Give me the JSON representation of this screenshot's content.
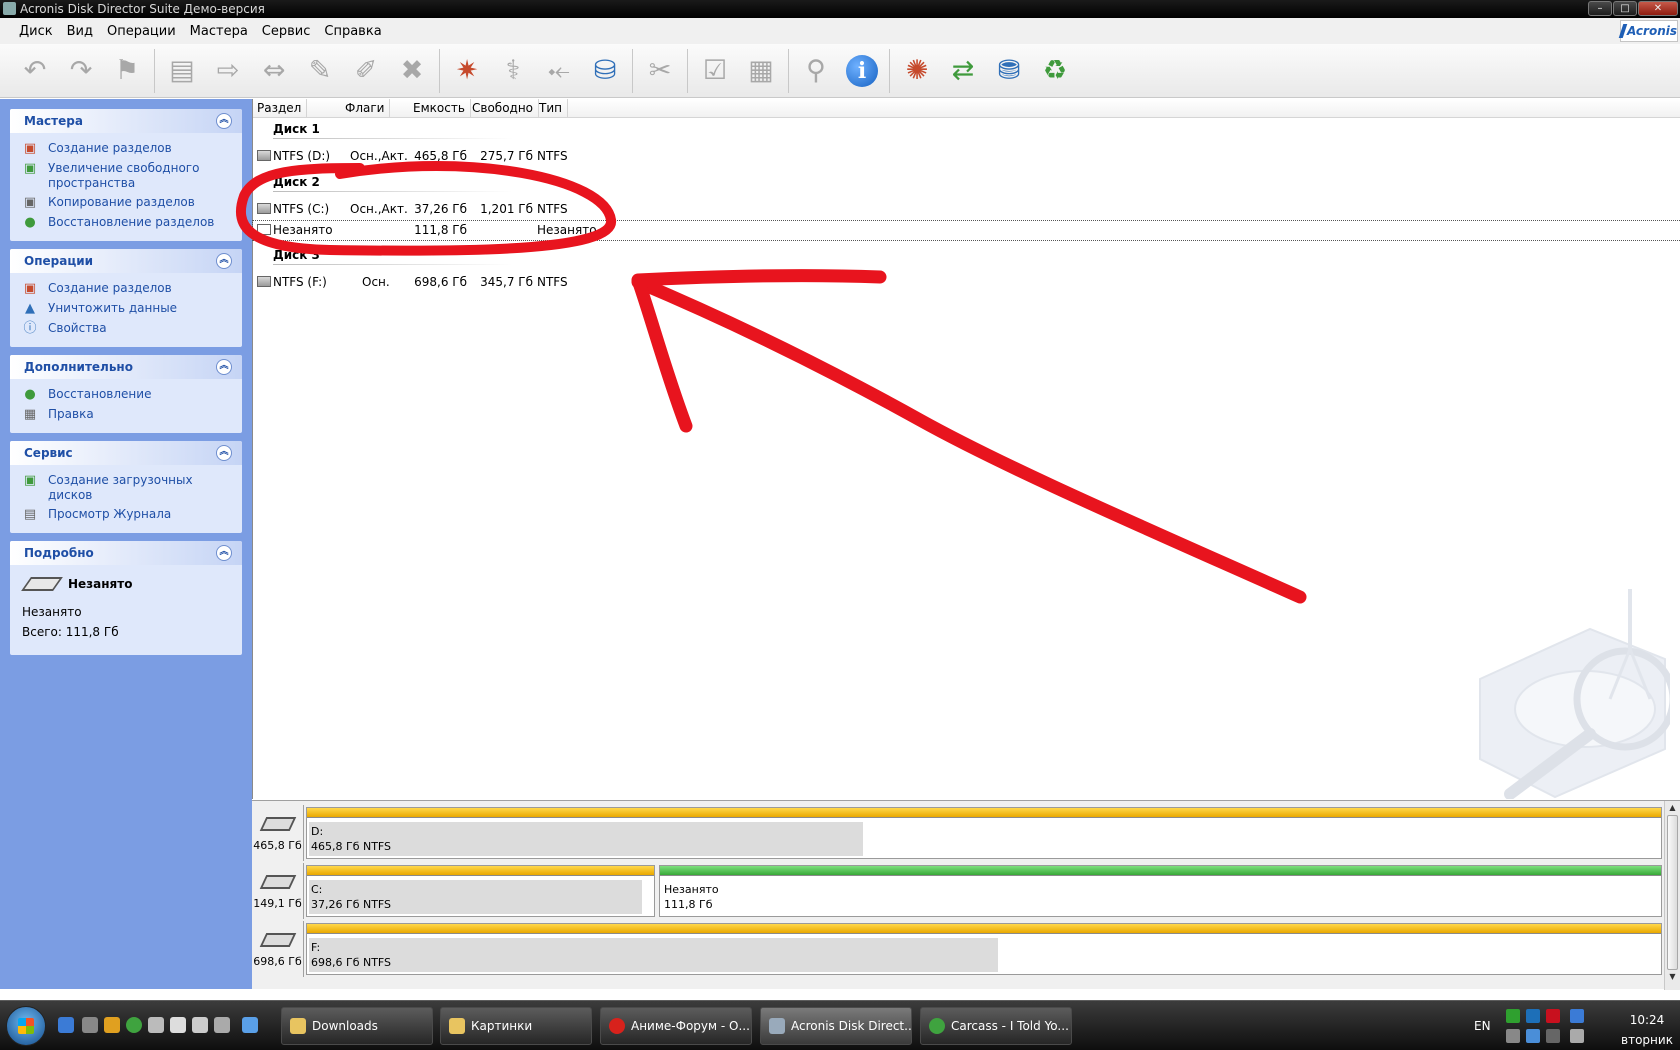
{
  "window": {
    "title": "Acronis Disk Director Suite Демо-версия",
    "controls": {
      "minimize": "–",
      "maximize": "□",
      "close": "✕"
    }
  },
  "menu": [
    "Диск",
    "Вид",
    "Операции",
    "Мастера",
    "Сервис",
    "Справка"
  ],
  "brand": "Acronis",
  "toolbar": {
    "icons": [
      "undo-icon",
      "redo-icon",
      "commit-flag-icon",
      "create-partition-icon",
      "move-partition-icon",
      "resize-partition-icon",
      "label-icon",
      "format-icon",
      "delete-partition-icon",
      "create-partition-wizard-icon",
      "recovery-icon",
      "split-icon",
      "bootable-media-icon",
      "wipe-icon",
      "check-icon",
      "defrag-icon",
      "browse-icon",
      "info-icon",
      "increase-space-icon",
      "copy-partition-icon",
      "convert-icon",
      "recycle-icon"
    ],
    "info_glyph": "i"
  },
  "sidebar": {
    "groups": [
      {
        "title": "Мастера",
        "items": [
          {
            "label": "Создание разделов",
            "icon": "create-partition-icon"
          },
          {
            "label": "Увеличение свободного пространства",
            "icon": "increase-space-icon"
          },
          {
            "label": "Копирование разделов",
            "icon": "copy-partition-icon"
          },
          {
            "label": "Восстановление разделов",
            "icon": "recover-partition-icon"
          }
        ]
      },
      {
        "title": "Операции",
        "items": [
          {
            "label": "Создание разделов",
            "icon": "create-partition-icon"
          },
          {
            "label": "Уничтожить данные",
            "icon": "wipe-data-icon"
          },
          {
            "label": "Свойства",
            "icon": "info-icon"
          }
        ]
      },
      {
        "title": "Дополнительно",
        "items": [
          {
            "label": "Восстановление",
            "icon": "restore-icon"
          },
          {
            "label": "Правка",
            "icon": "edit-icon"
          }
        ]
      },
      {
        "title": "Сервис",
        "items": [
          {
            "label": "Создание загрузочных дисков",
            "icon": "bootable-media-icon"
          },
          {
            "label": "Просмотр Журнала",
            "icon": "log-icon"
          }
        ]
      }
    ],
    "details": {
      "title": "Подробно",
      "item_name": "Незанято",
      "line1": "Незанято",
      "line2": "Всего: 111,8 Гб"
    }
  },
  "list": {
    "columns": [
      "Раздел",
      "Флаги",
      "Емкость",
      "Свободно",
      "Тип"
    ],
    "disks": [
      {
        "name": "Диск 1",
        "partitions": [
          {
            "name": "NTFS (D:)",
            "flags": "Осн.,Акт.",
            "capacity": "465,8 Гб",
            "free": "275,7 Гб",
            "type": "NTFS"
          }
        ]
      },
      {
        "name": "Диск 2",
        "partitions": [
          {
            "name": "NTFS (C:)",
            "flags": "Осн.,Акт.",
            "capacity": "37,26 Гб",
            "free": "1,201 Гб",
            "type": "NTFS"
          },
          {
            "name": "Незанято",
            "flags": "",
            "capacity": "111,8 Гб",
            "free": "",
            "type": "Незанято"
          }
        ]
      },
      {
        "name": "Диск 3",
        "partitions": [
          {
            "name": "NTFS (F:)",
            "flags": "Осн.",
            "capacity": "698,6 Гб",
            "free": "345,7 Гб",
            "type": "NTFS"
          }
        ]
      }
    ]
  },
  "diskmap": [
    {
      "size": "465,8 Гб",
      "segments": [
        {
          "line1": "D:",
          "line2": "465,8 Гб  NTFS",
          "bar": "yellow",
          "used_fraction": 0.41
        }
      ]
    },
    {
      "size": "149,1 Гб",
      "segments": [
        {
          "line1": "C:",
          "line2": "37,26 Гб  NTFS",
          "bar": "yellow",
          "used_fraction": 0.97
        },
        {
          "line1": "Незанято",
          "line2": "111,8 Гб",
          "bar": "green",
          "used_fraction": 0
        }
      ]
    },
    {
      "size": "698,6 Гб",
      "segments": [
        {
          "line1": "F:",
          "line2": "698,6 Гб  NTFS",
          "bar": "yellow",
          "used_fraction": 0.51
        }
      ]
    }
  ],
  "taskbar": {
    "buttons": [
      "Downloads",
      "Картинки",
      "Аниме-Форум - О...",
      "Acronis Disk Direct...",
      "Carcass - I Told Yo..."
    ],
    "active_button": "Acronis Disk Direct...",
    "language": "EN",
    "clock": "10:24",
    "day": "вторник"
  },
  "colors": {
    "annotation": "#e8141e",
    "task_pane": "#7b9de3",
    "link": "#1f4fa6"
  }
}
